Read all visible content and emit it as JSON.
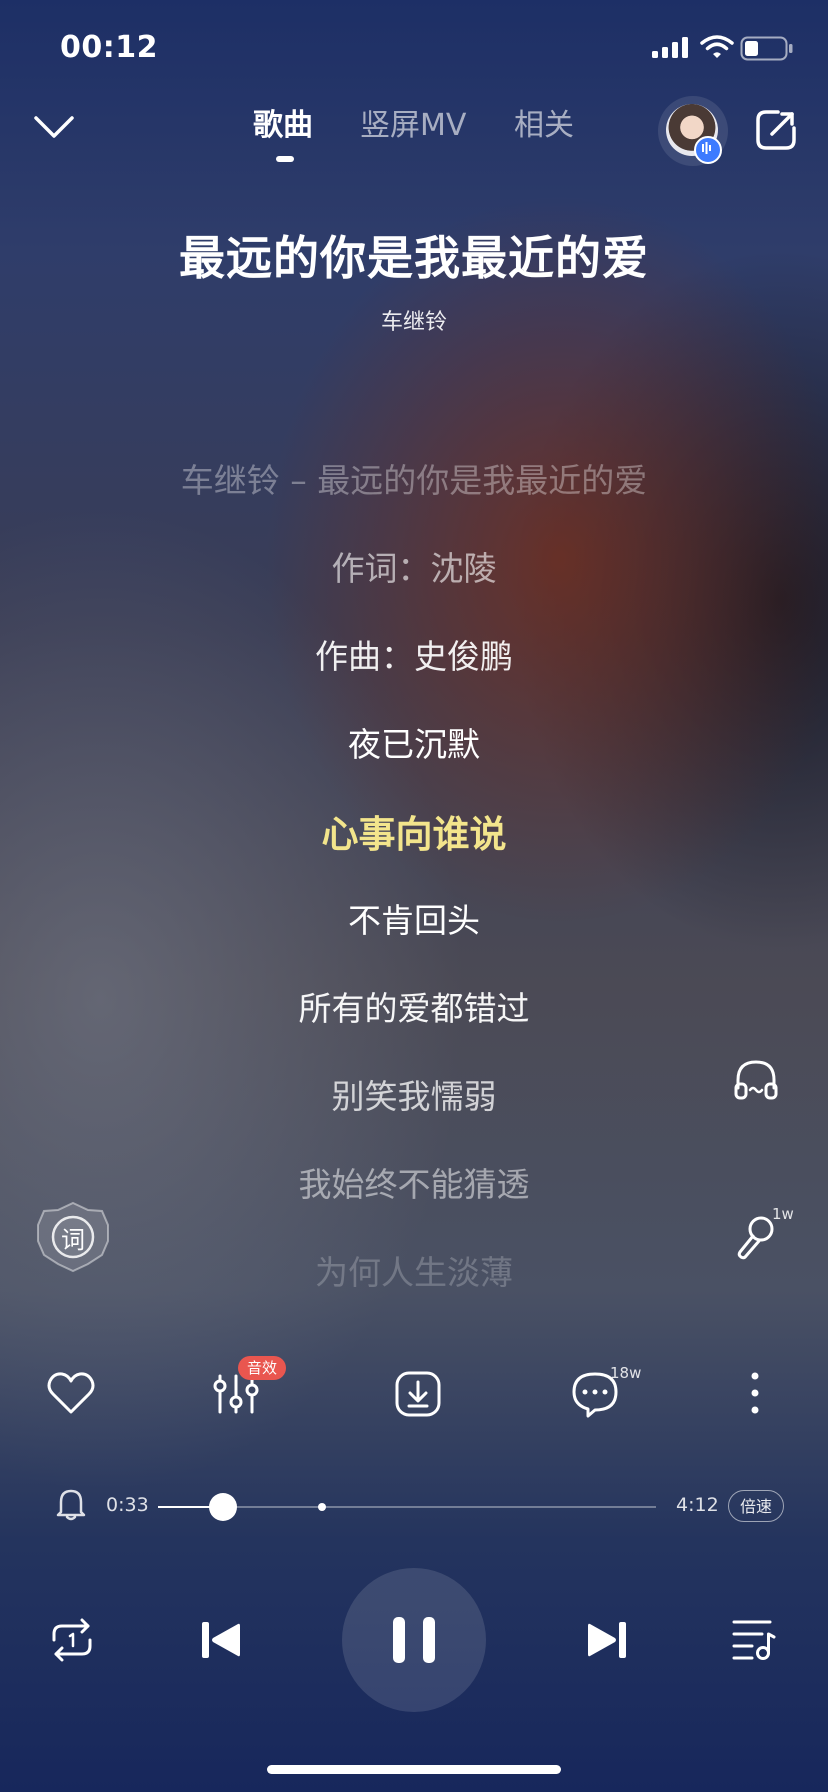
{
  "status_bar": {
    "time": "00:12"
  },
  "tabs": [
    {
      "label": "歌曲",
      "active": true
    },
    {
      "label": "竖屏MV",
      "active": false
    },
    {
      "label": "相关",
      "active": false
    }
  ],
  "song": {
    "title": "最远的你是我最近的爱",
    "artist": "车继铃"
  },
  "lyrics": [
    {
      "text": "车继铃 – 最远的你是我最近的爱",
      "state": "past-faded"
    },
    {
      "text": "作词：沈陵",
      "state": "past"
    },
    {
      "text": "作曲：史俊鹏",
      "state": "normal"
    },
    {
      "text": "夜已沉默",
      "state": "normal"
    },
    {
      "text": "心事向谁说",
      "state": "current"
    },
    {
      "text": "不肯回头",
      "state": "normal"
    },
    {
      "text": "所有的爱都错过",
      "state": "normal"
    },
    {
      "text": "别笑我懦弱",
      "state": "dim"
    },
    {
      "text": "我始终不能猜透",
      "state": "dimmer"
    },
    {
      "text": "为何人生淡薄",
      "state": "faded"
    }
  ],
  "side": {
    "lyric_button": "词",
    "sing_count": "1w"
  },
  "actions": {
    "effects_badge": "音效",
    "comment_count": "18w"
  },
  "player": {
    "current_time": "0:33",
    "total_time": "4:12",
    "progress": 0.131,
    "buffered_marker": 0.329,
    "speed_label": "倍速"
  },
  "colors": {
    "current_lyric": "#f3e58c",
    "effects_badge": "#e9564f",
    "avatar_badge": "#3d7bff"
  }
}
